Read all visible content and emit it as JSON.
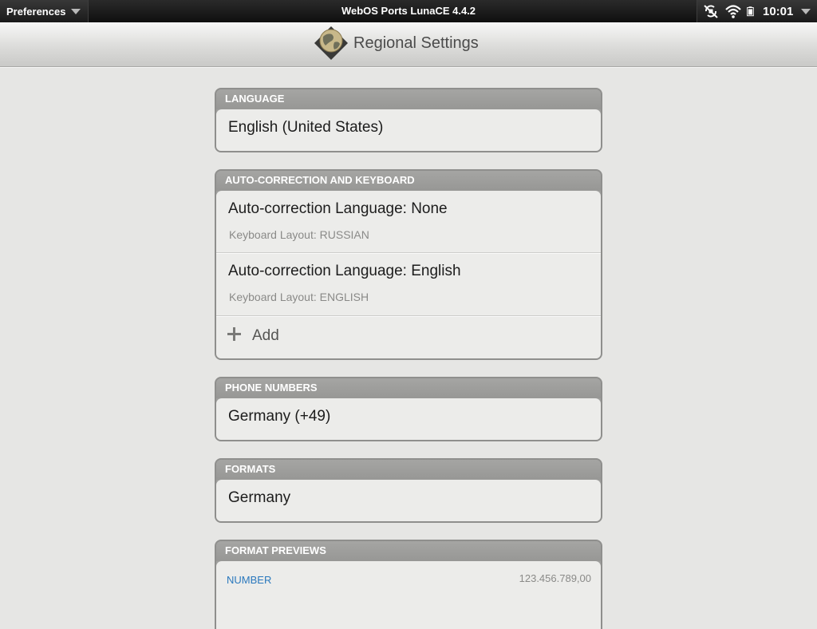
{
  "statusbar": {
    "app_menu_label": "Preferences",
    "carrier_title": "WebOS Ports LunaCE 4.4.2",
    "clock": "10:01",
    "icons": [
      "rotation-lock-icon",
      "wifi-icon",
      "battery-icon"
    ]
  },
  "header": {
    "title": "Regional Settings",
    "icon": "globe-icon"
  },
  "groups": {
    "language": {
      "title": "LANGUAGE",
      "value": "English (United States)"
    },
    "keyboard": {
      "title": "AUTO-CORRECTION AND KEYBOARD",
      "items": [
        {
          "language": "Auto-correction Language: None",
          "layout": "Keyboard Layout: RUSSIAN"
        },
        {
          "language": "Auto-correction Language: English",
          "layout": "Keyboard Layout: ENGLISH"
        }
      ],
      "add_label": "Add"
    },
    "phone": {
      "title": "PHONE NUMBERS",
      "value": "Germany (+49)"
    },
    "formats": {
      "title": "FORMATS",
      "value": "Germany"
    },
    "previews": {
      "title": "FORMAT PREVIEWS",
      "items": [
        {
          "label": "NUMBER",
          "value": "123.456.789,00"
        }
      ]
    }
  },
  "colors": {
    "accent_blue": "#2a78bd",
    "group_header": "#9f9f9d",
    "group_body": "#ececea",
    "background": "#e6e6e4"
  }
}
